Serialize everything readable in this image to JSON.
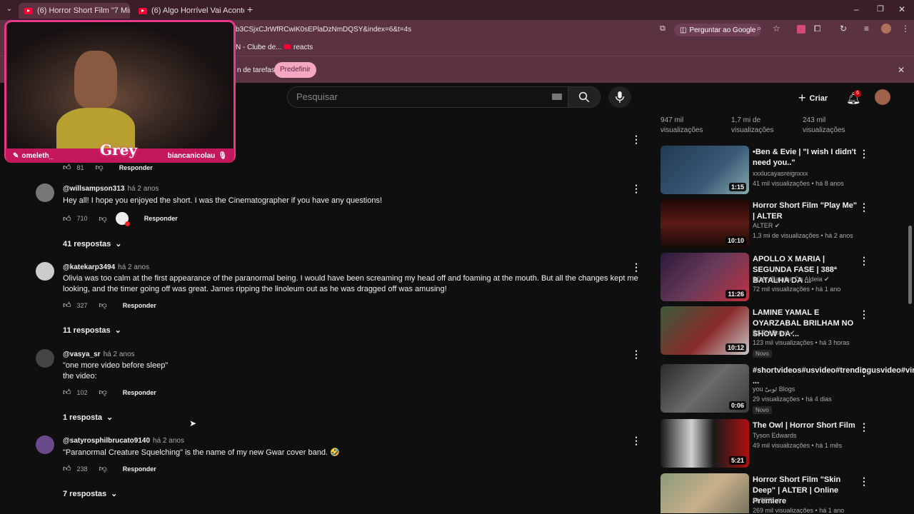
{
  "browser": {
    "tabs": [
      {
        "label": "(6) Horror Short Film \"7 Minut",
        "active": true
      },
      {
        "label": "(6) Algo Horrível Vai Acontecer",
        "active": false
      }
    ],
    "new_tab": "+",
    "url": "b3CSjxCJrWfRCwiK0sEPlaDzNmDQSY&index=6&t=4s",
    "ask_google": "Perguntar ao Google",
    "bookmarks": [
      {
        "label": "N - Clube de..."
      },
      {
        "label": "reacts"
      }
    ],
    "infobar": {
      "text": "n de tarefas",
      "button": "Predefinir"
    }
  },
  "header": {
    "search_placeholder": "Pesquisar",
    "create_label": "Criar",
    "notif_count": "6"
  },
  "webcam": {
    "left_name": "omeleth_",
    "center_name": "Grey",
    "right_name": "biancanicolau"
  },
  "comments": [
    {
      "likes": "81",
      "reply": "Responder"
    },
    {
      "author": "@willsampson313",
      "ago": "há 2 anos",
      "text": "Hey all! I hope you enjoyed the short. I was the Cinematographer if you have any questions!",
      "likes": "710",
      "reply": "Responder",
      "replies": "41 respostas"
    },
    {
      "author": "@katekarp3494",
      "ago": "há 2 anos",
      "text": "Olivia was too calm at the first appearance of the paranormal being. I would have been screaming my head off and foaming at the mouth. But all the changes kept me looking, and the timer going off was great. James ripping the linoleum out as he was dragged off was amusing!",
      "likes": "327",
      "reply": "Responder",
      "replies": "11 respostas"
    },
    {
      "author": "@vasya_sr",
      "ago": "há 2 anos",
      "text": "\"one more video before sleep\"",
      "text2": "the video:",
      "likes": "102",
      "reply": "Responder",
      "replies": "1 resposta"
    },
    {
      "author": "@satyrosphilbrucato9140",
      "ago": "há 2 anos",
      "text": "\"Paranormal Creature Squelching\" is the name of my new Gwar cover band. 🤣",
      "likes": "238",
      "reply": "Responder",
      "replies": "7 respostas"
    }
  ],
  "sidebar": {
    "top_views": [
      "947 mil",
      "visualizações",
      "1,7 mi de",
      "visualizações",
      "243 mil",
      "visualizações"
    ],
    "items": [
      {
        "title": "•Ben & Evie | \"I wish I didn't need you..\"",
        "channel": "xxxlucayasreignxxx",
        "meta": "41 mil visualizações • há 8 anos",
        "duration": "1:15",
        "thumb": "#3b5a78"
      },
      {
        "title": "Horror Short Film \"Play Me\" | ALTER",
        "channel": "ALTER ✔",
        "meta": "1,3 mi de visualizações • há 2 anos",
        "duration": "10:10",
        "thumb": "#5a1a14"
      },
      {
        "title": "APOLLO X MARIA | SEGUNDA FASE | 388ª BATALHA DA ...",
        "channel": "BDA - Batalha Da Aldeia ✔",
        "meta": "72 mil visualizações • há 1 ano",
        "duration": "11:26",
        "thumb": "#4a2a5a"
      },
      {
        "title": "LAMINE YAMAL E OYARZABAL BRILHAM NO SHOW DA ...",
        "channel": "ESPN Brasil ✔",
        "meta": "123 mil visualizações • há 3 horas",
        "duration": "10:12",
        "new": "Novo",
        "thumb": "#8a2a2a"
      },
      {
        "title": "#shortvideos#usvideo#trendingusvideo#viral ...",
        "channel": "you ٹوبیّ Blogs",
        "meta": "29 visualizações • há 4 dias",
        "duration": "0:06",
        "new": "Novo",
        "thumb": "#4a4a4a"
      },
      {
        "title": "The Owl | Horror Short Film",
        "channel": "Tyson Edwards",
        "meta": "49 mil visualizações • há 1 mês",
        "duration": "5:21",
        "thumb": "#2a2a2a"
      },
      {
        "title": "Horror Short Film \"Skin Deep\" | ALTER | Online Premiere",
        "channel": "ALTER ✔",
        "meta": "269 mil visualizações • há 1 ano",
        "duration": "",
        "thumb": "#6a6a5a"
      }
    ]
  }
}
